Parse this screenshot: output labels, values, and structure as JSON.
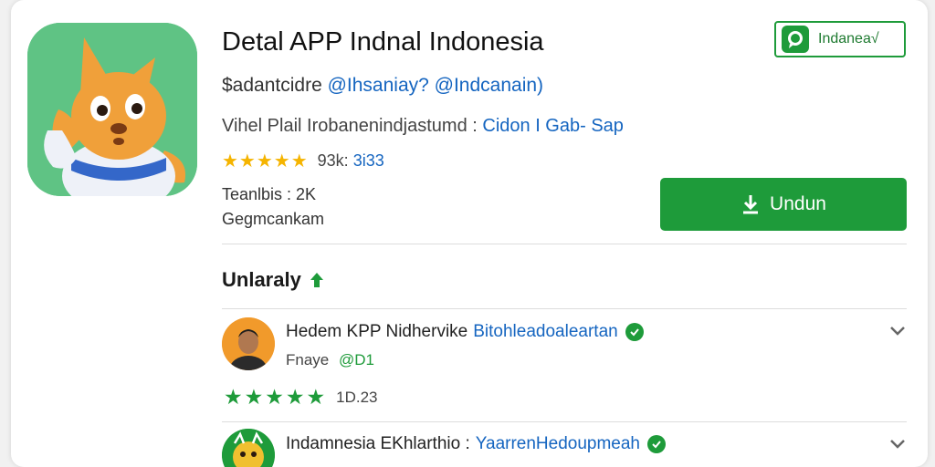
{
  "app": {
    "title": "Detal APP Indnal Indonesia",
    "developer_label": "$adantcidre",
    "developer_handle": "@Ihsaniay? @Indcanain)",
    "meta_label": "Vihel Plail Irobanenindjastumd :",
    "meta_link": "Cidon I Gab- Sap",
    "rating_stars": "★★★★★",
    "rating_count": "93k:",
    "rating_value": "3i33",
    "info_line1": "Teanlbis : 2K",
    "info_line2": "Gegmcankam",
    "badge_label": "Indanea√",
    "download_label": "Undun"
  },
  "section": {
    "title": "Unlaraly"
  },
  "reviews": [
    {
      "name": "Hedem KPP Nidhervike",
      "link": "Bitohleadoaleartan",
      "sub_label": "Fnaye",
      "sub_value": "@D1",
      "stars": "★★★★★",
      "date": "1D.23"
    },
    {
      "name": "Indamnesia EKhlarthio :",
      "link": "YaarrenHedoupmeah",
      "sub_label": "",
      "sub_value": "",
      "stars": "",
      "date": ""
    }
  ],
  "colors": {
    "accent_green": "#1e9b3a",
    "link_blue": "#1565c0",
    "star_gold": "#f5b400",
    "icon_bg": "#5fc384"
  },
  "icons": {
    "app_icon": "kangaroo-mascot-icon",
    "badge_icon": "chat-bubble-icon",
    "download_icon": "download-arrow-icon",
    "section_icon": "arrow-up-icon",
    "verified_icon": "verified-check-icon",
    "expand_icon": "chevron-down-icon"
  }
}
